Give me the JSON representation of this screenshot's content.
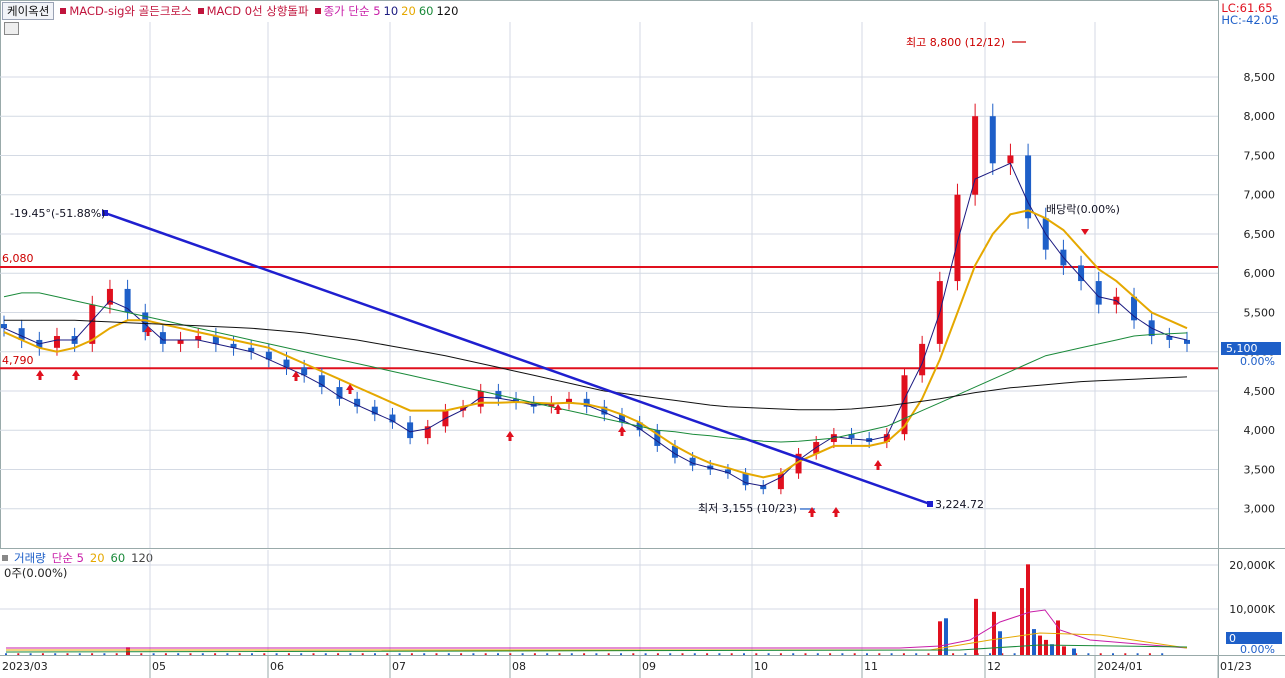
{
  "toolbar": {
    "tab": "케이옥션",
    "indicators": [
      {
        "label": "MACD-sig와 골든크로스",
        "color": "#c0143c"
      },
      {
        "label": "MACD 0선 상향돌파",
        "color": "#c0143c"
      }
    ],
    "ma_label": "종가 단순 5",
    "ma_periods": [
      {
        "label": "10",
        "color": "#1a1a80"
      },
      {
        "label": "20",
        "color": "#e5a800"
      },
      {
        "label": "60",
        "color": "#1a8a3a"
      },
      {
        "label": "120",
        "color": "#111111"
      }
    ]
  },
  "top_right": {
    "lc": "LC:61.65",
    "hc": "HC:-42.05"
  },
  "price_axis": {
    "ticks": [
      "8,500",
      "8,000",
      "7,500",
      "7,000",
      "6,500",
      "6,000",
      "5,500",
      "5,000",
      "4,500",
      "4,000",
      "3,500",
      "3,000"
    ],
    "current_price": "5,100",
    "current_pct": "0.00%"
  },
  "annotations": {
    "high": "최고 8,800 (12/12)",
    "low": "최저 3,155 (10/23)",
    "trend_start": "-19.45°(-51.88%)",
    "trend_end": "3,224.72",
    "hline_top": "6,080",
    "hline_bottom": "4,790",
    "dividend": "배당락(0.00%)"
  },
  "volume_panel": {
    "title": "거래량",
    "ma_label": "단순 5",
    "periods": [
      {
        "label": "20",
        "color": "#e5a800"
      },
      {
        "label": "60",
        "color": "#1a8a3a"
      },
      {
        "label": "120",
        "color": "#444444"
      }
    ],
    "sub": "0주(0.00%)",
    "ticks": [
      "20,000K",
      "10,000K",
      "0.00%"
    ],
    "current": "0"
  },
  "x_axis": [
    "2023/03",
    "05",
    "06",
    "07",
    "08",
    "09",
    "10",
    "11",
    "12",
    "2024/01",
    "01/23"
  ],
  "colors": {
    "up": "#e0101e",
    "down": "#1e5fc8",
    "trend": "#1f1fcf",
    "hline": "#e0101e"
  },
  "chart_data": {
    "type": "candlestick",
    "title": "케이옥션",
    "x": [
      "2023/03",
      "05",
      "06",
      "07",
      "08",
      "09",
      "10",
      "11",
      "12",
      "2024/01"
    ],
    "ylim": [
      2800,
      9000
    ],
    "y_ticks": [
      3000,
      3500,
      4000,
      4500,
      5000,
      5500,
      6000,
      6500,
      7000,
      7500,
      8000,
      8500
    ],
    "horizontal_lines": [
      6080,
      4790
    ],
    "high": {
      "value": 8800,
      "date": "12/12"
    },
    "low": {
      "value": 3155,
      "date": "10/23"
    },
    "trendline": {
      "start": 6700,
      "end": 3224.72,
      "angle": "-19.45°",
      "change": "-51.88%"
    },
    "last_close": 5100,
    "series": [
      {
        "name": "종가",
        "values": [
          5300,
          5150,
          5050,
          5200,
          5100,
          5600,
          5800,
          5500,
          5250,
          5100,
          5150,
          5200,
          5100,
          5050,
          5000,
          4900,
          4800,
          4700,
          4550,
          4400,
          4300,
          4200,
          4100,
          3900,
          4050,
          4250,
          4300,
          4500,
          4400,
          4350,
          4300,
          4350,
          4400,
          4300,
          4200,
          4100,
          4000,
          3800,
          3650,
          3550,
          3500,
          3450,
          3300,
          3250,
          3450,
          3700,
          3850,
          3950,
          3900,
          3850,
          3950,
          4700,
          5100,
          5900,
          7000,
          8000,
          7400,
          7500,
          6700,
          6300,
          6100,
          5900,
          5600,
          5700,
          5400,
          5200,
          5150,
          5100
        ]
      },
      {
        "name": "5",
        "values": [
          5300,
          5200,
          5100,
          5150,
          5150,
          5400,
          5650,
          5550,
          5350,
          5150,
          5150,
          5150,
          5100,
          5050,
          5000,
          4900,
          4800,
          4700,
          4580,
          4430,
          4320,
          4220,
          4120,
          3980,
          4020,
          4150,
          4260,
          4420,
          4410,
          4370,
          4320,
          4330,
          4360,
          4320,
          4230,
          4130,
          4020,
          3860,
          3700,
          3580,
          3520,
          3460,
          3330,
          3290,
          3400,
          3620,
          3780,
          3920,
          3890,
          3870,
          3920,
          4400,
          4850,
          5500,
          6400,
          7200,
          7300,
          7400,
          6900,
          6500,
          6200,
          5950,
          5700,
          5650,
          5450,
          5300,
          5200,
          5150
        ]
      },
      {
        "name": "20",
        "values": [
          5250,
          5150,
          5050,
          5000,
          5050,
          5150,
          5300,
          5400,
          5400,
          5350,
          5300,
          5250,
          5200,
          5150,
          5100,
          5050,
          4950,
          4850,
          4750,
          4650,
          4550,
          4450,
          4350,
          4250,
          4250,
          4250,
          4300,
          4350,
          4350,
          4360,
          4350,
          4340,
          4350,
          4330,
          4280,
          4200,
          4100,
          3950,
          3800,
          3680,
          3580,
          3520,
          3450,
          3400,
          3450,
          3600,
          3700,
          3800,
          3800,
          3800,
          3850,
          4050,
          4400,
          4900,
          5500,
          6100,
          6500,
          6750,
          6800,
          6700,
          6550,
          6300,
          6050,
          5900,
          5700,
          5500,
          5400,
          5300
        ]
      },
      {
        "name": "60",
        "values": [
          5700,
          5750,
          5750,
          5700,
          5650,
          5600,
          5550,
          5500,
          5450,
          5400,
          5350,
          5300,
          5250,
          5200,
          5150,
          5100,
          5050,
          5000,
          4950,
          4900,
          4850,
          4800,
          4750,
          4700,
          4650,
          4600,
          4550,
          4500,
          4450,
          4400,
          4350,
          4300,
          4250,
          4200,
          4150,
          4100,
          4050,
          4000,
          3980,
          3950,
          3930,
          3900,
          3880,
          3860,
          3850,
          3860,
          3880,
          3900,
          3950,
          4000,
          4050,
          4150,
          4250,
          4350,
          4450,
          4550,
          4650,
          4750,
          4850,
          4950,
          5000,
          5050,
          5100,
          5150,
          5200,
          5220,
          5230,
          5240
        ]
      },
      {
        "name": "120",
        "values": [
          5400,
          5400,
          5400,
          5400,
          5400,
          5390,
          5380,
          5370,
          5360,
          5350,
          5340,
          5330,
          5320,
          5310,
          5300,
          5280,
          5260,
          5240,
          5210,
          5180,
          5150,
          5110,
          5070,
          5030,
          4990,
          4950,
          4900,
          4850,
          4800,
          4750,
          4700,
          4650,
          4600,
          4550,
          4500,
          4470,
          4440,
          4410,
          4380,
          4350,
          4320,
          4300,
          4290,
          4280,
          4270,
          4260,
          4260,
          4260,
          4270,
          4290,
          4310,
          4340,
          4370,
          4400,
          4440,
          4480,
          4510,
          4540,
          4560,
          4580,
          4600,
          4620,
          4630,
          4640,
          4650,
          4660,
          4670,
          4680
        ]
      }
    ]
  }
}
